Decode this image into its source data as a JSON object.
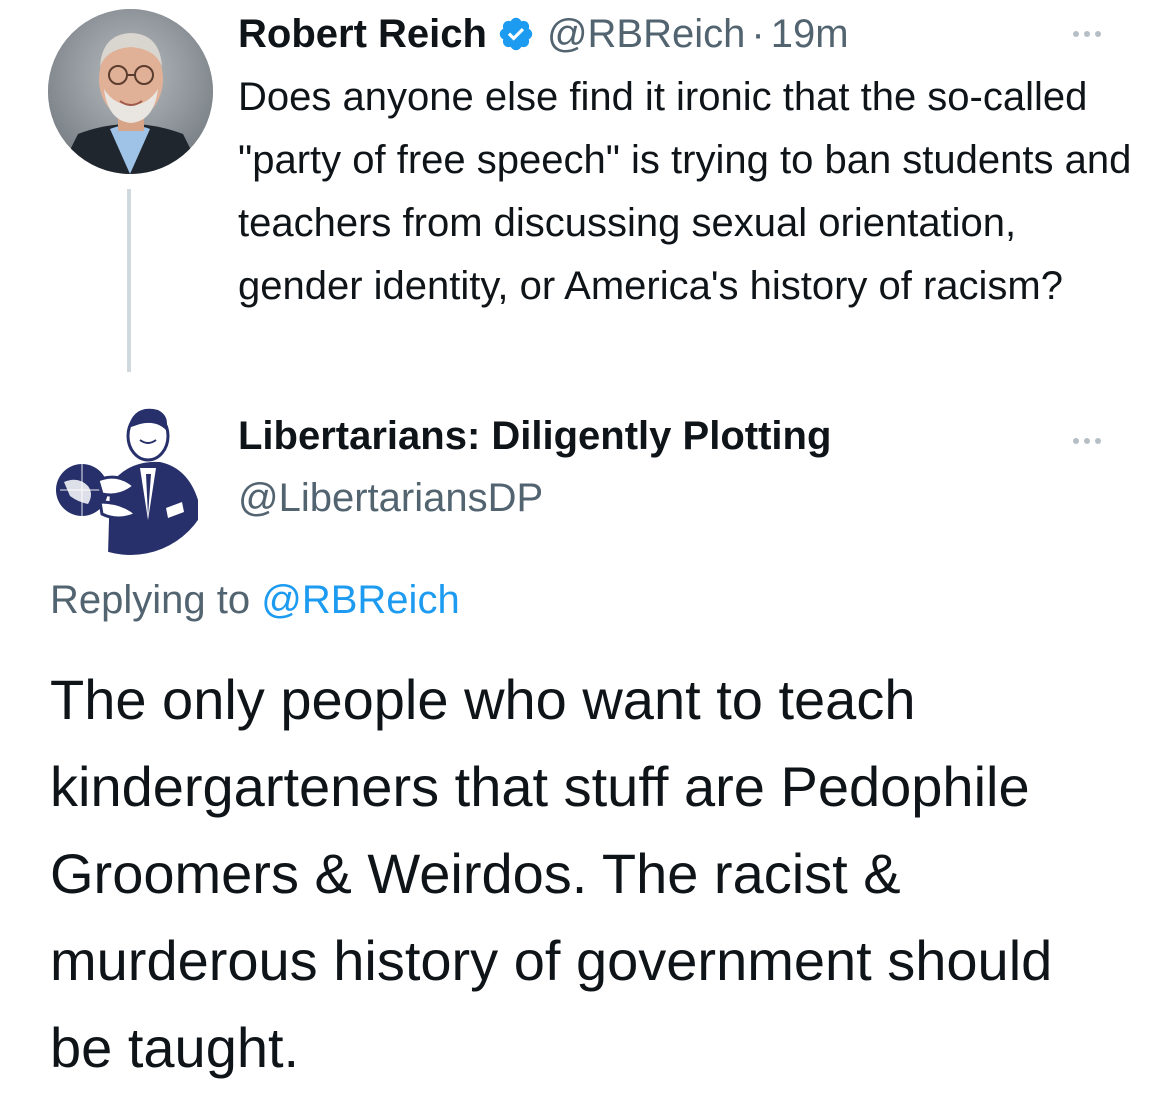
{
  "parent_tweet": {
    "display_name": "Robert Reich",
    "handle": "@RBReich",
    "separator": "·",
    "timestamp": "19m",
    "verified_color": "#1d9bf0",
    "text": "Does anyone else find it ironic that the so-called \"party of free speech\" is trying to ban students and teachers from discussing sexual orientation, gender identity, or America's history of racism?"
  },
  "reply_tweet": {
    "display_name": "Libertarians: Diligently Plotting",
    "handle": "@LibertariansDP",
    "replying_prefix": "Replying to",
    "replying_to": "@RBReich",
    "text": "The only people who want to teach kindergarteners that stuff are Pedophile Groomers & Weirdos. The racist & murderous history of government should be taught."
  },
  "icons": {
    "verified": "verified-badge-icon",
    "more": "more-options-icon"
  },
  "colors": {
    "text_primary": "#0f1419",
    "text_secondary": "#536471",
    "link": "#1d9bf0",
    "thread_line": "#cfd9de",
    "illustration_blue": "#27306b"
  }
}
